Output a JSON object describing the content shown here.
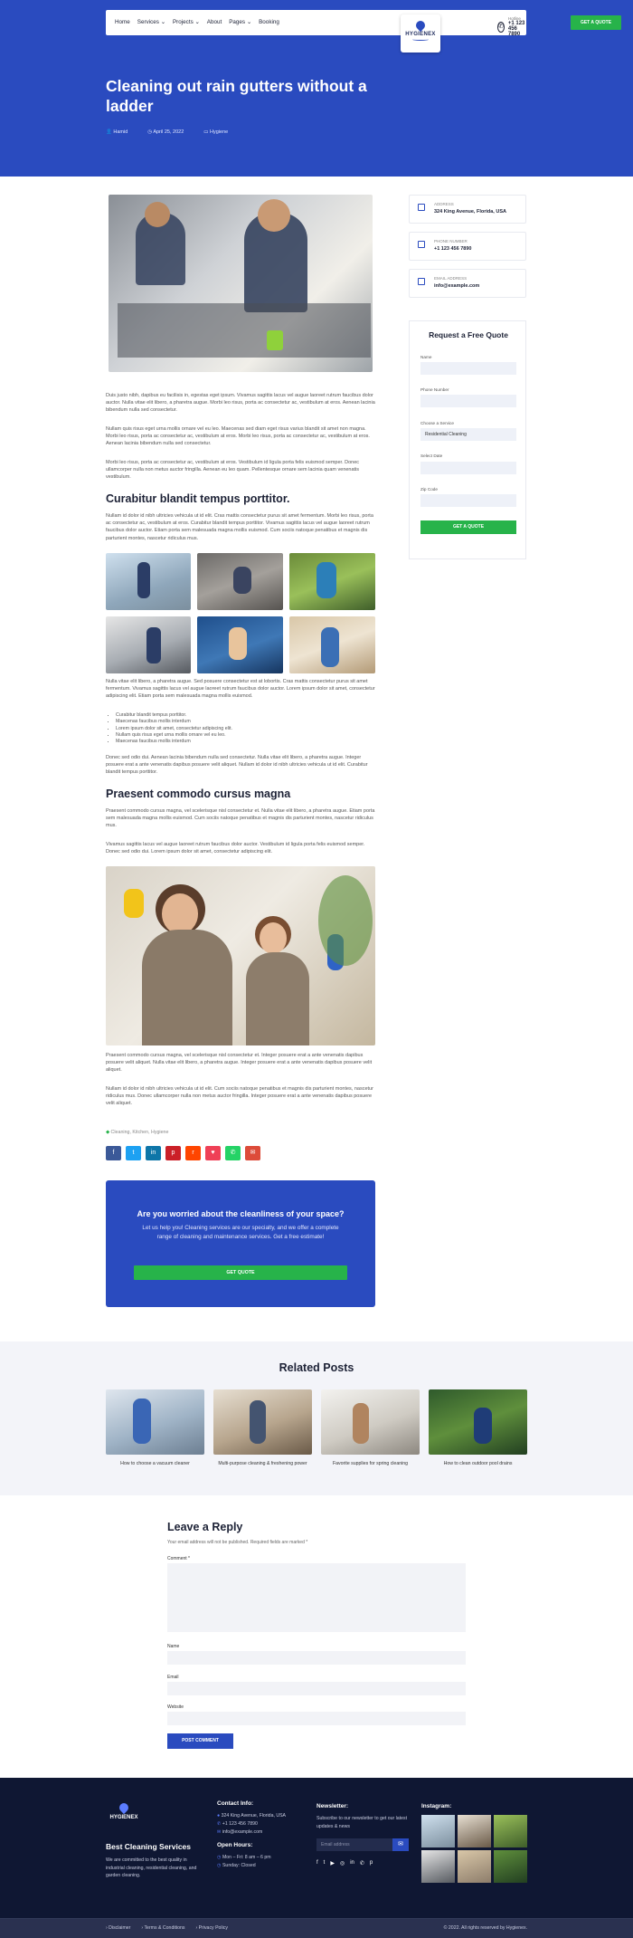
{
  "nav": {
    "items": [
      "Home",
      "Services ⌄",
      "Projects ⌄",
      "About",
      "Pages ⌄",
      "Booking"
    ],
    "logo": "HYGIENEX",
    "phone_label": "Hotline",
    "phone_number": "+1 123 456 7890",
    "quote_button": "GET A QUOTE"
  },
  "hero": {
    "title": "Cleaning out rain gutters without a ladder",
    "author": "Hamid",
    "date": "April 25, 2022",
    "category": "Hygiene"
  },
  "article": {
    "p1": "Duis justo nibh, dapibus eu facilisis in, egestas eget ipsum. Vivamus sagittis lacus vel augue laoreet rutrum faucibus dolor auctor. Nulla vitae elit libero, a pharetra augue. Morbi leo risus, porta ac consectetur ac, vestibulum at eros. Aenean lacinia bibendum nulla sed consectetur.",
    "p2": "Nullam quis risus eget urna mollis ornare vel eu leo. Maecenas sed diam eget risus varius blandit sit amet non magna. Morbi leo risus, porta ac consectetur ac, vestibulum at eros. Morbi leo risus, porta ac consectetur ac, vestibulum at eros. Aenean lacinia bibendum nulla sed consectetur.",
    "p3": "Morbi leo risus, porta ac consectetur ac, vestibulum at eros. Vestibulum id ligula porta felis euismod semper. Donec ullamcorper nulla non metus auctor fringilla. Aenean eu leo quam. Pellentesque ornare sem lacinia quam venenatis vestibulum.",
    "h2a": "Curabitur blandit tempus porttitor.",
    "p4": "Nullam id dolor id nibh ultricies vehicula ut id elit. Cras mattis consectetur purus sit amet fermentum. Morbi leo risus, porta ac consectetur ac, vestibulum at eros. Curabitur blandit tempus porttitor. Vivamus sagittis lacus vel augue laoreet rutrum faucibus dolor auctor. Etiam porta sem malesuada magna mollis euismod. Cum sociis natoque penatibus et magnis dis parturient montes, nascetur ridiculus mus.",
    "p5": "Nulla vitae elit libero, a pharetra augue. Sed posuere consectetur est at lobortis. Cras mattis consectetur purus sit amet fermentum. Vivamus sagittis lacus vel augue laoreet rutrum faucibus dolor auctor. Lorem ipsum dolor sit amet, consectetur adipiscing elit. Etiam porta sem malesuada magna mollis euismod.",
    "list": [
      "Curabitur blandit tempus porttitor.",
      "Maecenas faucibus mollis interdum",
      "Lorem ipsum dolor sit amet, consectetur adipiscing elit.",
      "Nullam quis risus eget urna mollis ornare vel eu leo.",
      "Maecenas faucibus mollis interdum"
    ],
    "p6": "Donec sed odio dui. Aenean lacinia bibendum nulla sed consectetur. Nulla vitae elit libero, a pharetra augue. Integer posuere erat a ante venenatis dapibus posuere velit aliquet. Nullam id dolor id nibh ultricies vehicula ut id elit. Curabitur blandit tempus porttitor.",
    "h2b": "Praesent commodo cursus magna",
    "p7": "Praesent commodo cursus magna, vel scelerisque nisl consectetur et. Nulla vitae elit libero, a pharetra augue. Etiam porta sem malesuada magna mollis euismod. Cum sociis natoque penatibus et magnis dis parturient montes, nascetur ridiculus mus.",
    "p8": "Vivamus sagittis lacus vel augue laoreet rutrum faucibus dolor auctor. Vestibulum id ligula porta felis euismod semper. Donec sed odio dui. Lorem ipsum dolor sit amet, consectetur adipiscing elit.",
    "p9": "Praesent commodo cursus magna, vel scelerisque nisl consectetur et. Integer posuere erat a ante venenatis dapibus posuere velit aliquet. Nulla vitae elit libero, a pharetra augue. Integer posuere erat a ante venenatis dapibus posuere velit aliquet.",
    "p10": "Nullam id dolor id nibh ultricies vehicula ut id elit. Cum sociis natoque penatibus et magnis dis parturient montes, nascetur ridiculus mus. Donec ullamcorper nulla non metus auctor fringilla. Integer posuere erat a ante venenatis dapibus posuere velit aliquet.",
    "tags": "Cleaning, Kitchen, Hygiene"
  },
  "sidebar": {
    "address_label": "ADDRESS",
    "address": "324 King Avenue, Florida, USA",
    "phone_label": "PHONE NUMBER",
    "phone": "+1 123 456 7890",
    "email_label": "EMAIL ADDRESS",
    "email": "info@example.com",
    "form_title": "Request a Free Quote",
    "name_label": "Name",
    "phone_field_label": "Phone Number",
    "service_label": "Choose a Service",
    "service_value": "Residential Cleaning",
    "date_label": "Select Date",
    "zip_label": "Zip Code",
    "submit": "GET A QUOTE"
  },
  "cta": {
    "title": "Are you worried about the cleanliness of your space?",
    "text": "Let us help you! Cleaning services are our specialty, and we offer a complete range of cleaning and maintenance services. Get a free estimate!",
    "button": "GET QUOTE"
  },
  "related": {
    "title": "Related Posts",
    "posts": [
      "How to choose a vacuum cleaner",
      "Multi-purpose cleaning & freshening power",
      "Favorite supplies for spring cleaning",
      "How to clean outdoor pool drains"
    ]
  },
  "reply": {
    "title": "Leave a Reply",
    "note": "Your email address will not be published. Required fields are marked *",
    "comment_label": "Comment *",
    "name_label": "Name",
    "email_label": "Email",
    "website_label": "Website",
    "button": "POST COMMENT"
  },
  "footer": {
    "logo": "HYGIENEX",
    "heading": "Best Cleaning Services",
    "about": "We are committed to the best quality in industrial cleaning, residential cleaning, and garden cleaning.",
    "contact_title": "Contact Info:",
    "contact_address": "324 King Avenue, Florida, USA",
    "contact_phone": "+1 123 456 7890",
    "contact_email": "info@example.com",
    "hours_title": "Open Hours:",
    "hours_weekdays": "Mon – Fri: 8 am – 6 pm",
    "hours_sunday": "Sunday: Closed",
    "newsletter_title": "Newsletter:",
    "newsletter_text": "Subscribe to our newsletter to get our latest updates & news",
    "email_placeholder": "Email address",
    "instagram_title": "Instagram:",
    "bottom_links": [
      "Disclaimer",
      "Terms & Conditions",
      "Privacy Policy"
    ],
    "copyright": "© 2022. All rights reserved by Hygienex."
  },
  "colors": {
    "primary": "#2a4bbf",
    "accent": "#27b34a",
    "footer": "#0f1733"
  }
}
